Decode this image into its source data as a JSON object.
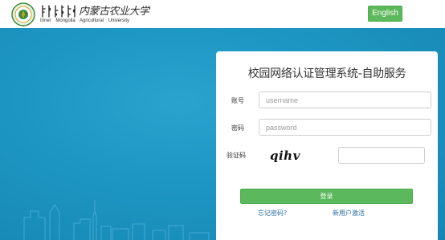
{
  "header": {
    "logo_cn": "内蒙古农业大学",
    "logo_en": "Inner Mongolia Agricultural University",
    "language_button": "English"
  },
  "login": {
    "title": "校园网络认证管理系统-自助服务",
    "account_label": "账号",
    "account_placeholder": "username",
    "password_label": "密码",
    "password_placeholder": "password",
    "captcha_label": "验证码",
    "captcha_text": "qihv",
    "captcha_value": "",
    "submit_label": "登录",
    "forgot_link": "忘记密码?",
    "activate_link": "新用户激活"
  },
  "colors": {
    "header_bg": "#ffffff",
    "background": "#1c93c0",
    "accent_green": "#5cb85c",
    "link_blue": "#2a6ea8"
  },
  "icons": [
    "university-emblem-icon",
    "mongolian-script-logo"
  ]
}
